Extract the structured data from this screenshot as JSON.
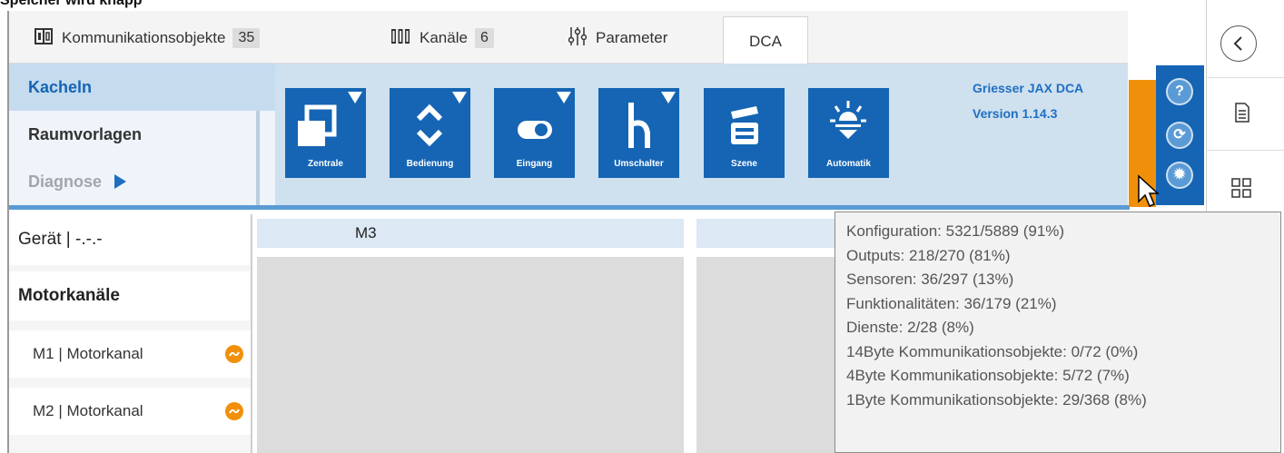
{
  "caption": "Speicher wird knapp",
  "tabs": [
    {
      "label": "Kommunikationsobjekte",
      "count": "35"
    },
    {
      "label": "Kanäle",
      "count": "6"
    },
    {
      "label": "Parameter"
    },
    {
      "label": "DCA"
    }
  ],
  "nav": {
    "kacheln": "Kacheln",
    "raumvorlagen": "Raumvorlagen",
    "diagnose": "Diagnose"
  },
  "tiles": [
    {
      "label": "Zentrale",
      "icon": "zentrale-icon"
    },
    {
      "label": "Bedienung",
      "icon": "updown-icon"
    },
    {
      "label": "Eingang",
      "icon": "toggle-icon"
    },
    {
      "label": "Umschalter",
      "icon": "switch-icon"
    },
    {
      "label": "Szene",
      "icon": "clapper-icon"
    },
    {
      "label": "Automatik",
      "icon": "sun-icon"
    }
  ],
  "version": {
    "product": "Griesser JAX DCA",
    "version": "Version 1.14.3"
  },
  "side_buttons": [
    {
      "glyph": "?",
      "icon": "help-icon"
    },
    {
      "glyph": "⟳",
      "icon": "refresh-icon"
    },
    {
      "glyph": "✹",
      "icon": "settings-icon"
    }
  ],
  "left_panel": {
    "device": "Gerät | -.-.-",
    "section": "Motorkanäle",
    "items": [
      {
        "label": "M1 | Motorkanal"
      },
      {
        "label": "M2 | Motorkanal"
      }
    ]
  },
  "content": {
    "column_title": "M3"
  },
  "tooltip": {
    "lines": [
      "Konfiguration: 5321/5889 (91%)",
      "Outputs: 218/270 (81%)",
      "Sensoren: 36/297 (13%)",
      "Funktionalitäten: 36/179 (21%)",
      "Dienste: 2/28 (8%)",
      "14Byte Kommunikationsobjekte: 0/72 (0%)",
      "4Byte Kommunikationsobjekte: 5/72 (7%)",
      "1Byte Kommunikationsobjekte: 29/368 (8%)"
    ]
  },
  "colors": {
    "accent": "#1565b4",
    "ribbon": "#cfe0ef",
    "warning": "#f0900a"
  }
}
